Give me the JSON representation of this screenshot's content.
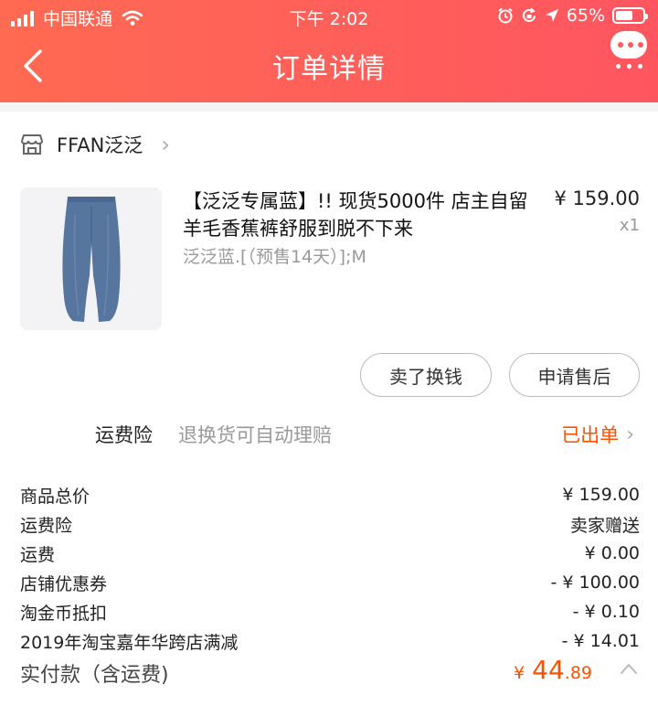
{
  "status_bar": {
    "carrier": "中国联通",
    "time": "下午 2:02",
    "battery": "65%",
    "battery_level": 0.65
  },
  "nav": {
    "title": "订单详情"
  },
  "shop": {
    "name": "FFAN泛泛"
  },
  "product": {
    "title": "【泛泛专属蓝】!! 现货5000件 店主自留羊毛香蕉裤舒服到脱不下来",
    "spec": "泛泛蓝.[（预售14天）];M",
    "price": "¥ 159.00",
    "quantity": "x1"
  },
  "actions": {
    "sell_label": "卖了换钱",
    "after_sale_label": "申请售后"
  },
  "insurance": {
    "label": "运费险",
    "description": "退换货可自动理赔",
    "status": "已出单"
  },
  "summary": [
    {
      "label": "商品总价",
      "value": "¥ 159.00"
    },
    {
      "label": "运费险",
      "value": "卖家赠送"
    },
    {
      "label": "运费",
      "value": "¥ 0.00"
    },
    {
      "label": "店铺优惠券",
      "value": "- ¥ 100.00"
    },
    {
      "label": "淘金币抵扣",
      "value": "- ¥ 0.10"
    },
    {
      "label": "2019年淘宝嘉年华跨店满减",
      "value": "- ¥ 14.01"
    }
  ],
  "total": {
    "label": "实付款（含运费)",
    "currency": "¥",
    "integer": "44",
    "decimal": ".89"
  },
  "colors": {
    "header_gradient_start": "#ff6a52",
    "header_gradient_end": "#ff5560",
    "accent_orange": "#ff5000",
    "muted_text": "#999999"
  },
  "icons": [
    "signal-bars-icon",
    "wifi-icon",
    "alarm-icon",
    "rotation-lock-icon",
    "location-arrow-icon",
    "battery-icon",
    "back-arrow-icon",
    "more-options-icon",
    "store-icon",
    "chevron-right-icon",
    "chevron-up-icon"
  ]
}
